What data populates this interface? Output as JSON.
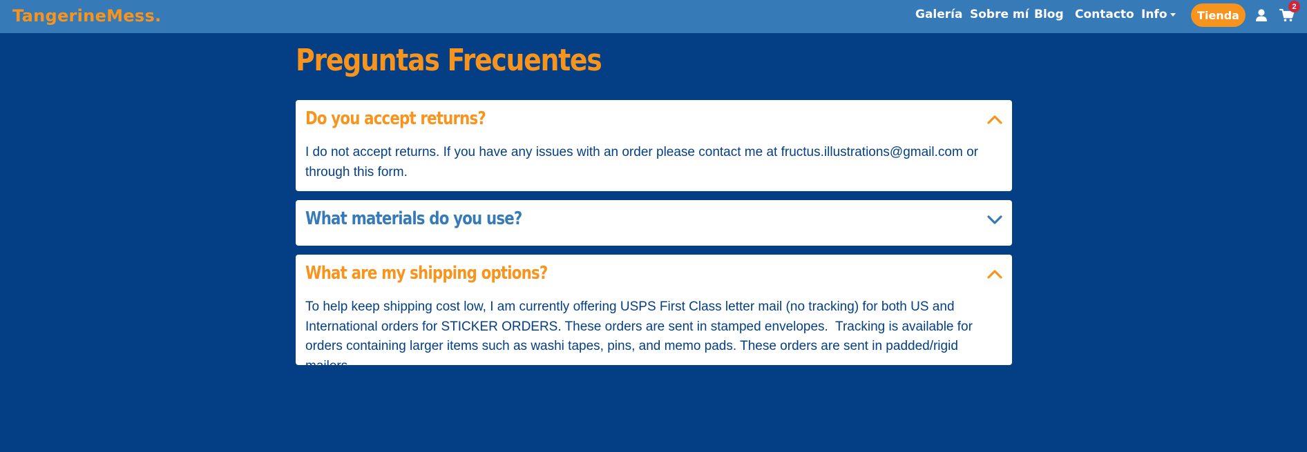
{
  "header": {
    "logo": "TangerineMess.",
    "nav": {
      "galeria": "Galería",
      "sobre_mi": "Sobre mí",
      "blog": "Blog",
      "contacto": "Contacto",
      "info": "Info"
    },
    "shop_label": "Tienda",
    "cart_count": "2"
  },
  "main": {
    "title": "Preguntas Frecuentes",
    "faqs": [
      {
        "question": "Do you accept returns?",
        "expanded": true,
        "answer": "I do not accept returns. If you have any issues with an order please contact me at fructus.illustrations@gmail.com or through this form."
      },
      {
        "question": "What materials do you use?",
        "expanded": false
      },
      {
        "question": "What are my shipping options?",
        "expanded": true,
        "answer": "To help keep shipping cost low, I am currently offering USPS First Class letter mail (no tracking) for both US and International orders for STICKER ORDERS. These orders are sent in stamped envelopes.  Tracking is available for orders containing larger items such as washi tapes, pins, and memo pads. These orders are sent in padded/rigid mailers."
      }
    ]
  },
  "colors": {
    "background": "#043f85",
    "header": "#377ab8",
    "accent": "#f7941d",
    "badge": "#d0263c"
  },
  "icons": [
    "user-icon",
    "cart-icon",
    "chevron-up-icon",
    "chevron-down-icon",
    "caret-down-icon"
  ]
}
